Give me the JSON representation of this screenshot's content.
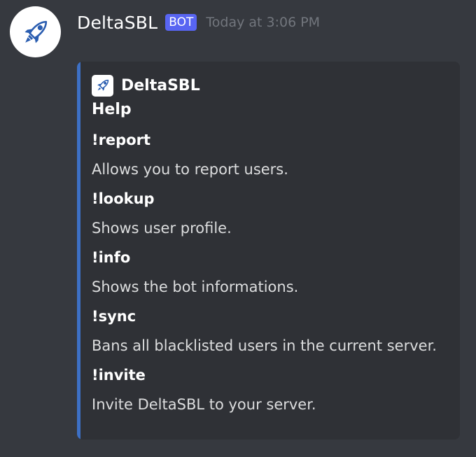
{
  "message": {
    "username": "DeltaSBL",
    "bot_tag": "BOT",
    "timestamp": "Today at 3:06 PM",
    "avatar_icon": "rocket-icon"
  },
  "embed": {
    "accent_color": "#3d70c5",
    "author": {
      "name": "DeltaSBL",
      "icon": "rocket-icon"
    },
    "title": "Help",
    "fields": [
      {
        "name": "!report",
        "value": "Allows you to report users."
      },
      {
        "name": "!lookup",
        "value": "Shows user profile."
      },
      {
        "name": "!info",
        "value": "Shows the bot informations."
      },
      {
        "name": "!sync",
        "value": "Bans all blacklisted users in the current server."
      },
      {
        "name": "!invite",
        "value": "Invite DeltaSBL to your server."
      }
    ]
  },
  "colors": {
    "background": "#36393f",
    "embed_background": "#2f3136",
    "bot_tag": "#5865f2",
    "timestamp": "#72767d"
  }
}
